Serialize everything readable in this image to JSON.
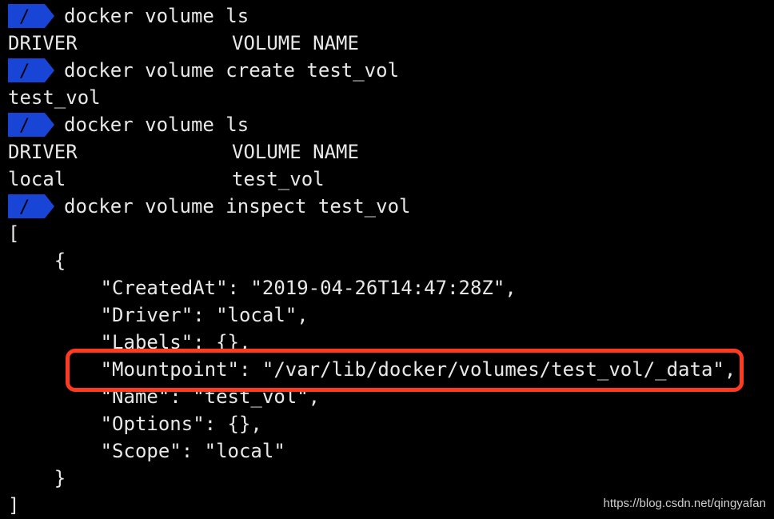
{
  "prompt": {
    "symbol": "/",
    "color": "#1845d6"
  },
  "lines": [
    {
      "type": "prompt",
      "text": "docker volume ls"
    },
    {
      "type": "cols",
      "col1": "DRIVER",
      "col2": "VOLUME NAME"
    },
    {
      "type": "prompt",
      "text": "docker volume create test_vol"
    },
    {
      "type": "text",
      "text": "test_vol"
    },
    {
      "type": "prompt",
      "text": "docker volume ls"
    },
    {
      "type": "cols",
      "col1": "DRIVER",
      "col2": "VOLUME NAME"
    },
    {
      "type": "cols",
      "col1": "local",
      "col2": "test_vol"
    },
    {
      "type": "prompt",
      "text": "docker volume inspect test_vol"
    },
    {
      "type": "text",
      "text": "["
    },
    {
      "type": "text",
      "text": "    {"
    },
    {
      "type": "text",
      "text": "        \"CreatedAt\": \"2019-04-26T14:47:28Z\","
    },
    {
      "type": "text",
      "text": "        \"Driver\": \"local\","
    },
    {
      "type": "text",
      "text": "        \"Labels\": {},"
    },
    {
      "type": "text",
      "text": "        \"Mountpoint\": \"/var/lib/docker/volumes/test_vol/_data\","
    },
    {
      "type": "text",
      "text": "        \"Name\": \"test_vol\","
    },
    {
      "type": "text",
      "text": "        \"Options\": {},"
    },
    {
      "type": "text",
      "text": "        \"Scope\": \"local\""
    },
    {
      "type": "text",
      "text": "    }"
    },
    {
      "type": "text",
      "text": "]"
    }
  ],
  "highlight_color": "#ff3b1f",
  "watermark": "https://blog.csdn.net/qingyafan"
}
